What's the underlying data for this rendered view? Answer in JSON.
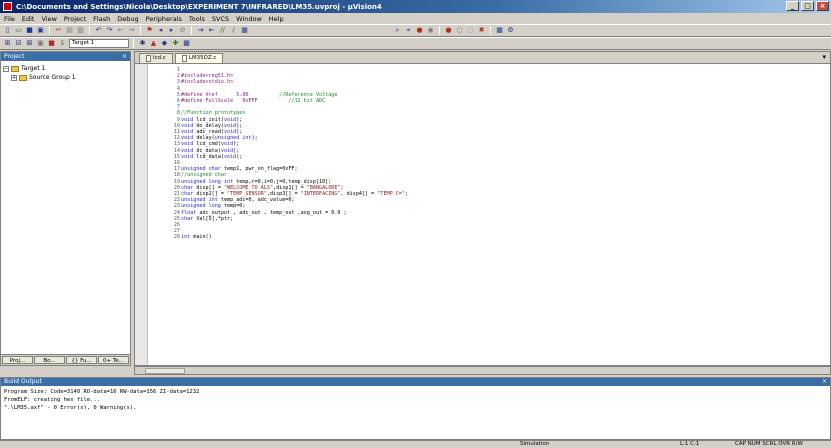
{
  "window": {
    "title": "C:\\Documents and Settings\\Nicola\\Desktop\\EXPERIMENT 7\\INFRARED\\LM35.uvproj - µVision4",
    "buttons": [
      "_",
      "□",
      "×"
    ]
  },
  "menu": [
    "File",
    "Edit",
    "View",
    "Project",
    "Flash",
    "Debug",
    "Peripherals",
    "Tools",
    "SVCS",
    "Window",
    "Help"
  ],
  "toolbar": {
    "target": "Target 1"
  },
  "project_pane": {
    "title": "Project",
    "close": "×",
    "tree": [
      {
        "toggle": "−",
        "label": "Target 1"
      },
      {
        "toggle": "+",
        "label": "Source Group 1"
      }
    ],
    "tabs": [
      "Proj...",
      "Bo...",
      "{} Fu...",
      "0+ Te..."
    ]
  },
  "editor": {
    "tabs": [
      {
        "label": "lcd.c"
      },
      {
        "label": "LM35DZ.c"
      }
    ],
    "arrow": "▾",
    "lines": [
      {
        "n": "1",
        "html": ""
      },
      {
        "n": "2",
        "html": "<span class='pp'>#include&lt;reg51.h&gt;</span>"
      },
      {
        "n": "3",
        "html": "<span class='pp'>#include&lt;stdio.h&gt;</span>"
      },
      {
        "n": "4",
        "html": ""
      },
      {
        "n": "5",
        "html": "<span class='pp'>#define Vref      5.00</span>          <span class='cm'>//Reference Voltage</span>"
      },
      {
        "n": "6",
        "html": "<span class='pp'>#define FullScale   0xFFF</span>          <span class='cm'>//12 bit ADC</span>"
      },
      {
        "n": "7",
        "html": ""
      },
      {
        "n": "8",
        "html": "<span class='cm'>//Function prototypes</span>"
      },
      {
        "n": "9",
        "html": "<span class='kw'>void</span> lcd_init(<span class='kw'>void</span>);"
      },
      {
        "n": "10",
        "html": "<span class='kw'>void</span> do_delay(<span class='kw'>void</span>);"
      },
      {
        "n": "11",
        "html": "<span class='kw'>void</span> adc_read(<span class='kw'>void</span>);"
      },
      {
        "n": "12",
        "html": "<span class='kw'>void</span> delay(<span class='kw'>unsigned int</span>);"
      },
      {
        "n": "13",
        "html": "<span class='kw'>void</span> lcd_cmd(<span class='kw'>void</span>);"
      },
      {
        "n": "14",
        "html": "<span class='kw'>void</span> dc_data(<span class='kw'>void</span>);"
      },
      {
        "n": "15",
        "html": "<span class='kw'>void</span> lcd_data(<span class='kw'>void</span>);"
      },
      {
        "n": "16",
        "html": ""
      },
      {
        "n": "17",
        "html": "<span class='kw'>unsigned char</span> temp1, pwr_on_flag=0xFF;"
      },
      {
        "n": "18",
        "html": "<span class='cm'>//unsigned char</span>"
      },
      {
        "n": "19",
        "html": "<span class='kw'>unsigned long int</span> temp,r=0,i=0,j=0,temp_disp[10];"
      },
      {
        "n": "20",
        "html": "<span class='kw'>char</span> disp[] = <span class='st'>\"WELCOME TO ALS\"</span>,disp1[] = <span class='st'>\"BANGALORE\"</span>;"
      },
      {
        "n": "21",
        "html": "<span class='kw'>char</span> disp2[] = <span class='st'>\"TEMP_SENSOR\"</span>,disp3[] = <span class='st'>\"INTERFACING\"</span>, disp4[] = <span class='st'>\"TEMP C=\"</span>;"
      },
      {
        "n": "22",
        "html": "<span class='kw'>unsigned int</span> temp_adc=0, adc_value=0;"
      },
      {
        "n": "23",
        "html": "<span class='kw'>unsigned long</span> temp=0;"
      },
      {
        "n": "24",
        "html": "<span class='kw'>float</span> adc_output , adc_out , temp_out ,avg_out = 0.0 ;"
      },
      {
        "n": "25",
        "html": "<span class='kw'>char</span> Val[5],*ptr;"
      },
      {
        "n": "26",
        "html": ""
      },
      {
        "n": "27",
        "html": ""
      },
      {
        "n": "28",
        "html": "<span class='kw'>int</span> main()"
      }
    ]
  },
  "output": {
    "title": "Build Output",
    "close": "×",
    "lines": [
      "Program Size: Code=3140 RO-data=16 RW-data=156 ZI-data=1232",
      "FromELF: creating hex file...",
      "\".\\LM35.axf\" - 0 Error(s), 0 Warning(s)."
    ]
  },
  "status": {
    "sim": "Simulation",
    "pos": "L:1 C:1",
    "caps": "CAP  NUM  SCRL  OVR  R/W"
  },
  "colors": {
    "title_bar": "#0a246a",
    "keyword": "#1f1fd8",
    "comment": "#1a8a2a",
    "string": "#8a1a1a"
  }
}
